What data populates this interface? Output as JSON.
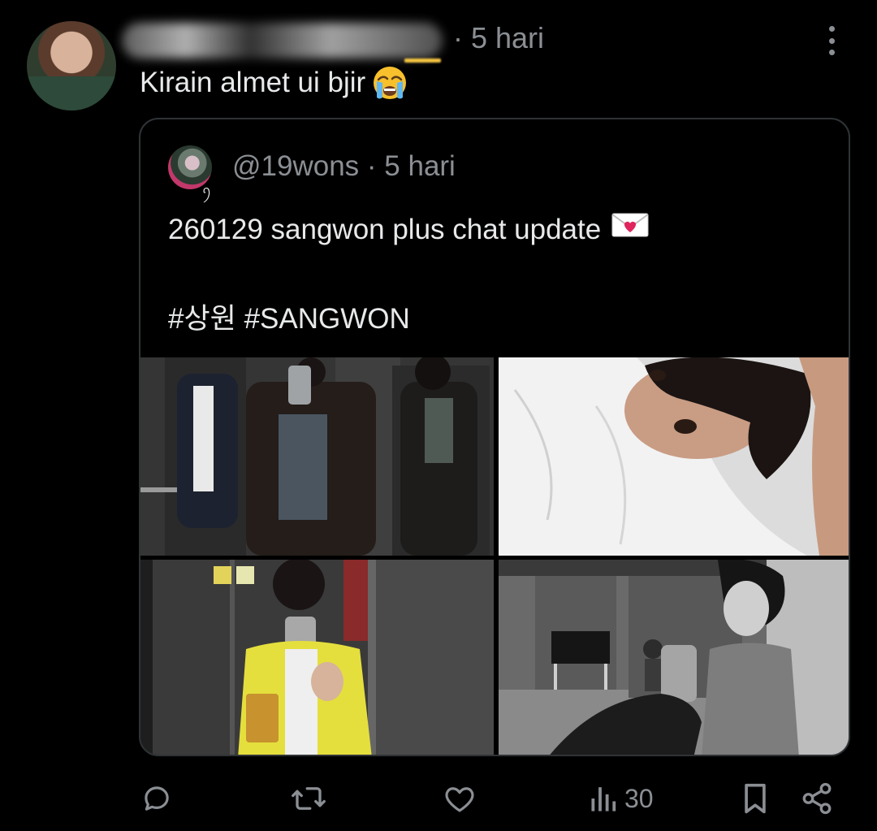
{
  "reply": {
    "time": "· 5 hari",
    "text": "Kirain almet ui bjir"
  },
  "quoted": {
    "handle": "@19wons",
    "time": "· 5 hari",
    "badge": "ꪆ",
    "line1": "260129 sangwon plus chat update",
    "line2": "#상원 #SANGWON",
    "photos": [
      "photo-elevator-mirror",
      "photo-bed-pillow",
      "photo-yellow-jacket-mirror",
      "photo-practice-room"
    ]
  },
  "actions": {
    "views_count": "30"
  },
  "icons": {
    "reply": "reply-icon",
    "retweet": "retweet-icon",
    "like": "heart-icon",
    "views": "views-icon",
    "bookmark": "bookmark-icon",
    "share": "share-icon",
    "more": "more-icon",
    "emoji_reply": "crying-face-emoji",
    "emoji_quote": "love-letter-emoji"
  },
  "colors": {
    "background": "#000000",
    "text_primary": "#e7e9ea",
    "text_secondary": "#8b8f94",
    "border": "#2f3336"
  }
}
